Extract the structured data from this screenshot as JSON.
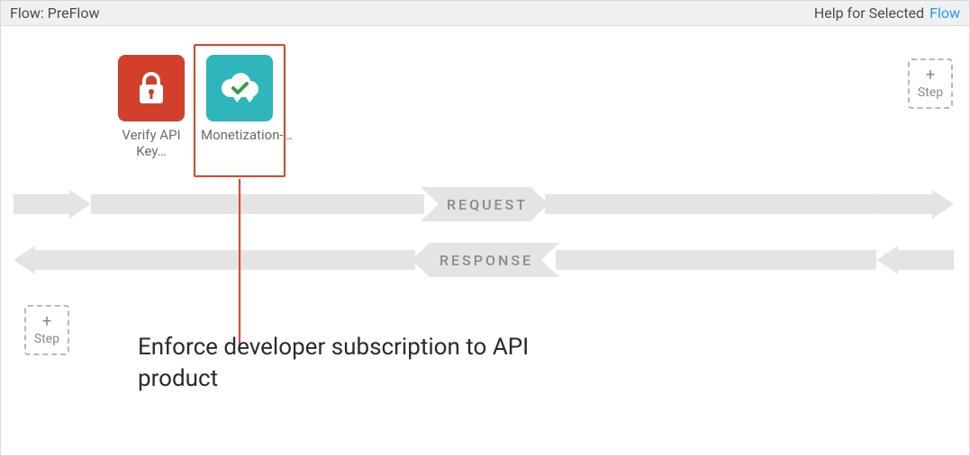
{
  "header": {
    "flow_label": "Flow: PreFlow",
    "help_label": "Help for Selected",
    "flow_link_label": "Flow"
  },
  "policies": [
    {
      "id": "verify-api-key",
      "label": "Verify API Key…",
      "selected": false
    },
    {
      "id": "monetization-limits",
      "label": "Monetization-…",
      "selected": true
    }
  ],
  "bands": {
    "request": "REQUEST",
    "response": "RESPONSE"
  },
  "add_step": {
    "plus": "+",
    "label": "Step"
  },
  "callout": "Enforce developer subscription to API product"
}
